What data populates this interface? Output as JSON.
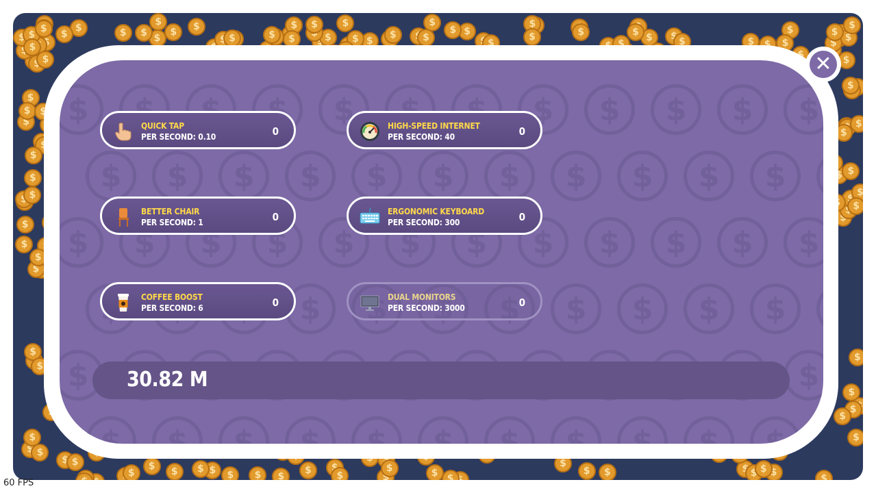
{
  "modal": {
    "close_icon": "close-icon",
    "upgrades": [
      {
        "name": "QUICK TAP",
        "rate": "PER SECOND: 0.10",
        "count": "0",
        "icon": "hand-tap-icon",
        "enabled": true
      },
      {
        "name": "HIGH-SPEED INTERNET",
        "rate": "PER SECOND: 40",
        "count": "0",
        "icon": "speedometer-icon",
        "enabled": true
      },
      {
        "name": "BETTER CHAIR",
        "rate": "PER SECOND: 1",
        "count": "0",
        "icon": "chair-icon",
        "enabled": true
      },
      {
        "name": "ERGONOMIC KEYBOARD",
        "rate": "PER SECOND: 300",
        "count": "0",
        "icon": "keyboard-icon",
        "enabled": true
      },
      {
        "name": "COFFEE BOOST",
        "rate": "PER SECOND: 6",
        "count": "0",
        "icon": "coffee-cup-icon",
        "enabled": true
      },
      {
        "name": "DUAL MONITORS",
        "rate": "PER SECOND: 3000",
        "count": "0",
        "icon": "monitor-icon",
        "enabled": false
      }
    ],
    "balance": "30.82 M"
  },
  "fps": "60 FPS",
  "colors": {
    "background": "#2c3a5e",
    "coin": "#e29a2c",
    "panel": "#7d6aa6",
    "upgrade_name": "#ffd84a"
  }
}
